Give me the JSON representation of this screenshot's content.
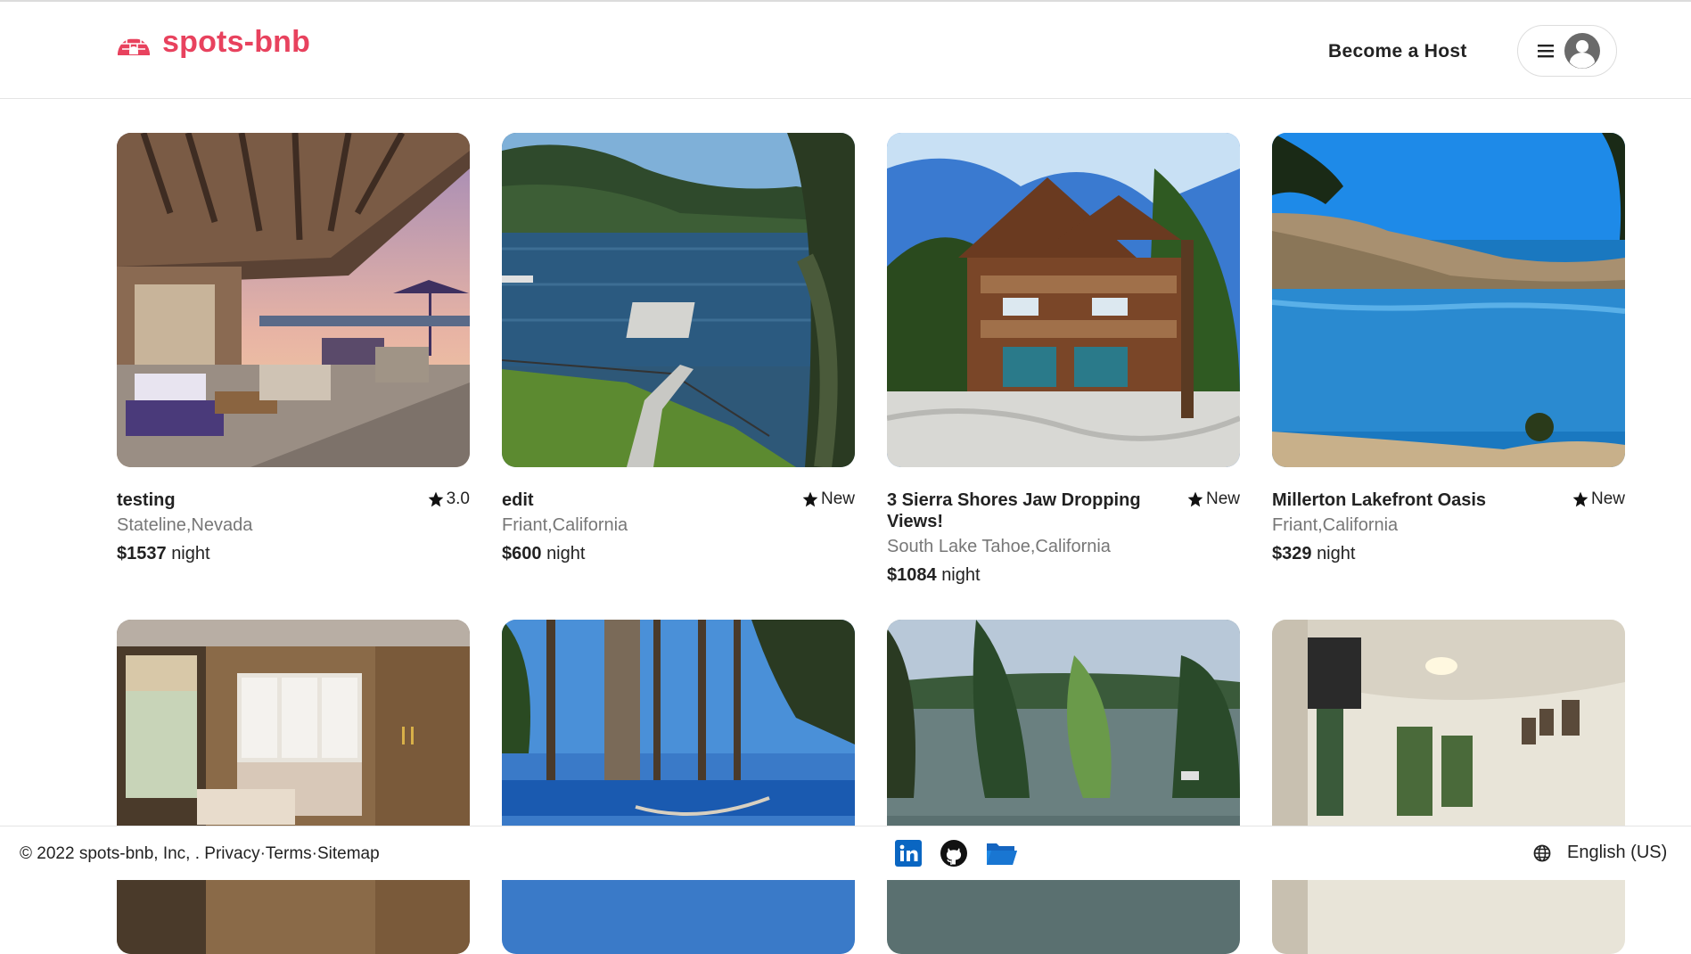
{
  "brand": {
    "name": "spots-bnb",
    "color": "#e8425e",
    "icon": "igloo-icon"
  },
  "header": {
    "become_host": "Become a Host",
    "menu_icon": "hamburger-icon",
    "avatar_icon": "user-avatar-icon"
  },
  "listings": [
    {
      "title": "testing",
      "rating": "3.0",
      "location": "Stateline,Nevada",
      "price": "$1537",
      "unit": "night",
      "image": "patio-dining-sunset"
    },
    {
      "title": "edit",
      "rating": "New",
      "location": "Friant,California",
      "price": "$600",
      "unit": "night",
      "image": "lake-dock-forest"
    },
    {
      "title": "3 Sierra Shores Jaw Dropping Views!",
      "rating": "New",
      "location": "South Lake Tahoe,California",
      "price": "$1084",
      "unit": "night",
      "image": "timber-lodge-snow"
    },
    {
      "title": "Millerton Lakefront Oasis",
      "rating": "New",
      "location": "Friant,California",
      "price": "$329",
      "unit": "night",
      "image": "lake-hills-blue-sky"
    },
    {
      "title": "",
      "rating": "",
      "location": "",
      "price": "",
      "unit": "",
      "image": "spa-room-cabinets"
    },
    {
      "title": "",
      "rating": "",
      "location": "",
      "price": "",
      "unit": "",
      "image": "pine-trees-lake-hammock"
    },
    {
      "title": "",
      "rating": "",
      "location": "",
      "price": "",
      "unit": "",
      "image": "lake-pines-dock"
    },
    {
      "title": "",
      "rating": "",
      "location": "",
      "price": "",
      "unit": "",
      "image": "bedroom-ceiling-light"
    }
  ],
  "footer": {
    "copyright": "© 2022 spots-bnb, Inc, . ",
    "privacy": "Privacy",
    "sep1": "·",
    "terms": "Terms",
    "sep2": "·",
    "sitemap": "Sitemap",
    "social_icons": [
      "linkedin-icon",
      "github-icon",
      "folder-icon"
    ],
    "language": "English (US)"
  }
}
